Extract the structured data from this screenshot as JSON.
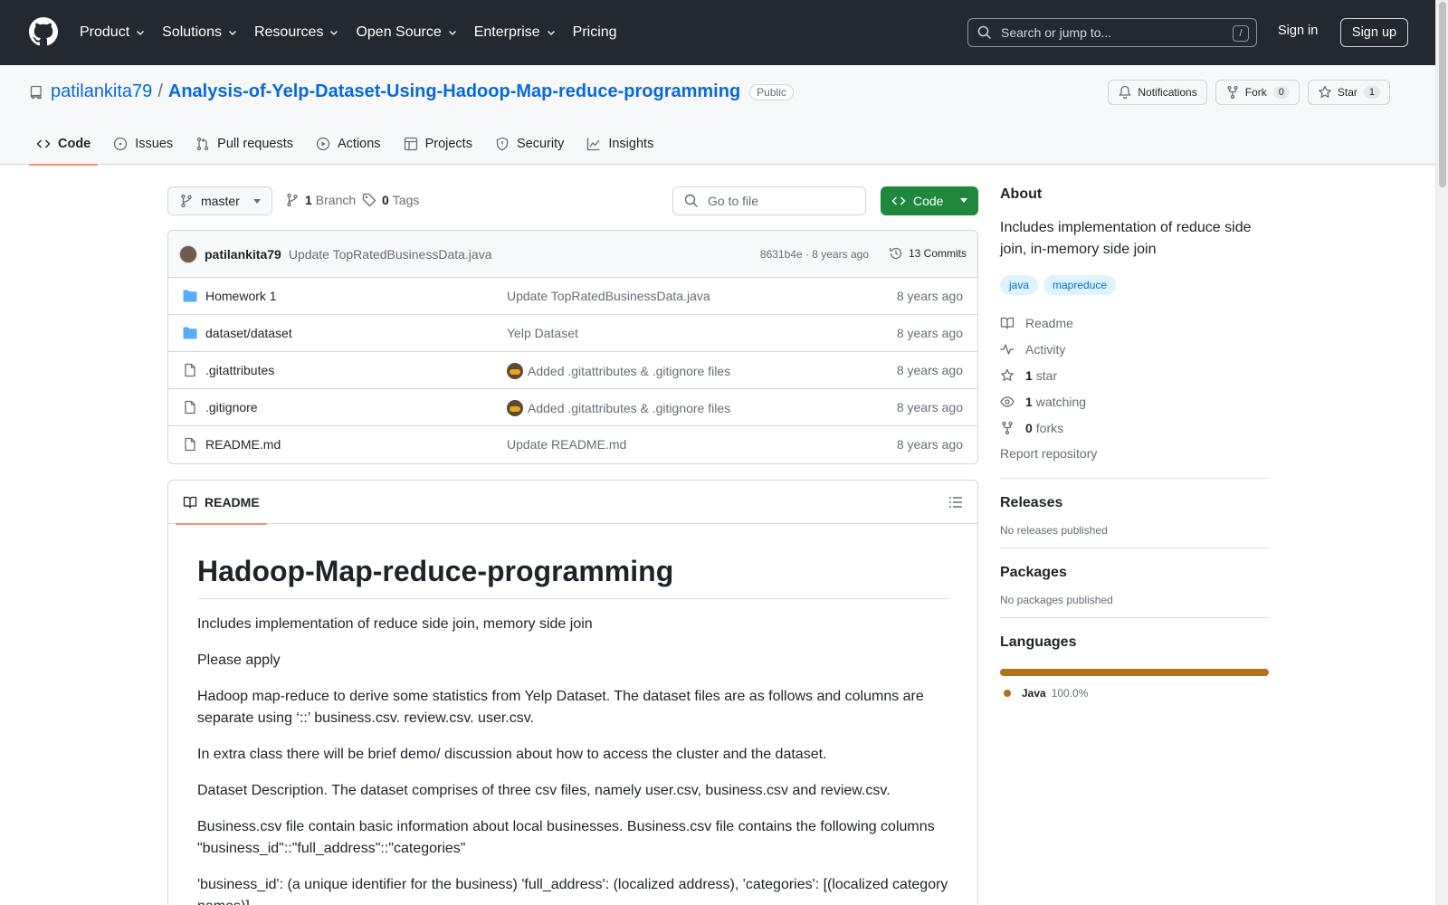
{
  "header": {
    "nav": [
      "Product",
      "Solutions",
      "Resources",
      "Open Source",
      "Enterprise",
      "Pricing"
    ],
    "search_placeholder": "Search or jump to...",
    "search_shortcut": "/",
    "signin": "Sign in",
    "signup": "Sign up"
  },
  "repo": {
    "owner": "patilankita79",
    "separator": "/",
    "name": "Analysis-of-Yelp-Dataset-Using-Hadoop-Map-reduce-programming",
    "visibility": "Public",
    "notifications_label": "Notifications",
    "fork_label": "Fork",
    "fork_count": "0",
    "star_label": "Star",
    "star_count": "1"
  },
  "tabs": [
    "Code",
    "Issues",
    "Pull requests",
    "Actions",
    "Projects",
    "Security",
    "Insights"
  ],
  "toolbar": {
    "branch": "master",
    "branch_count": "1",
    "branch_label": "Branch",
    "tag_count": "0",
    "tag_label": "Tags",
    "goto_file": "Go to file",
    "code_button": "Code"
  },
  "latest_commit": {
    "author": "patilankita79",
    "message": "Update TopRatedBusinessData.java",
    "meta": "8631b4e · 8 years ago",
    "commits": "13 Commits"
  },
  "files": [
    {
      "name": "Homework 1",
      "type": "folder",
      "message": "Update TopRatedBusinessData.java",
      "emoji": false,
      "date": "8 years ago"
    },
    {
      "name": "dataset/dataset",
      "type": "folder",
      "message": "Yelp Dataset",
      "emoji": false,
      "date": "8 years ago"
    },
    {
      "name": ".gitattributes",
      "type": "file",
      "message": "Added .gitattributes & .gitignore files",
      "emoji": true,
      "date": "8 years ago"
    },
    {
      "name": ".gitignore",
      "type": "file",
      "message": "Added .gitattributes & .gitignore files",
      "emoji": true,
      "date": "8 years ago"
    },
    {
      "name": "README.md",
      "type": "file",
      "message": "Update README.md",
      "emoji": false,
      "date": "8 years ago"
    }
  ],
  "readme": {
    "tab_label": "README",
    "title": "Hadoop-Map-reduce-programming",
    "paragraphs": [
      "Includes implementation of reduce side join, memory side join",
      "Please apply",
      "Hadoop map-reduce to derive some statistics from Yelp Dataset. The dataset files are as follows and columns are separate using ‘::’ business.csv. review.csv. user.csv.",
      "In extra class there will be brief demo/ discussion about how to access the cluster and the dataset.",
      "Dataset Description. The dataset comprises of three csv files, namely user.csv, business.csv and review.csv.",
      "Business.csv file contain basic information about local businesses. Business.csv file contains the following columns \"business_id\"::\"full_address\"::\"categories\"",
      "'business_id': (a unique identifier for the business) 'full_address': (localized address), 'categories': [(localized category names)]"
    ]
  },
  "sidebar": {
    "about_title": "About",
    "about_desc": "Includes implementation of reduce side join, in-memory side join",
    "topics": [
      "java",
      "mapreduce"
    ],
    "readme_link": "Readme",
    "activity_link": "Activity",
    "stars_count": "1",
    "stars_label": "star",
    "watching_count": "1",
    "watching_label": "watching",
    "forks_count": "0",
    "forks_label": "forks",
    "report": "Report repository",
    "releases_title": "Releases",
    "releases_note": "No releases published",
    "packages_title": "Packages",
    "packages_note": "No packages published",
    "languages_title": "Languages",
    "language_name": "Java",
    "language_pct": "100.0%",
    "language_color": "#b07219"
  },
  "colors": {
    "header_bg": "#24292f",
    "link": "#0969da",
    "primary_button": "#1f883d",
    "active_tab_underline": "#fd8c73"
  }
}
